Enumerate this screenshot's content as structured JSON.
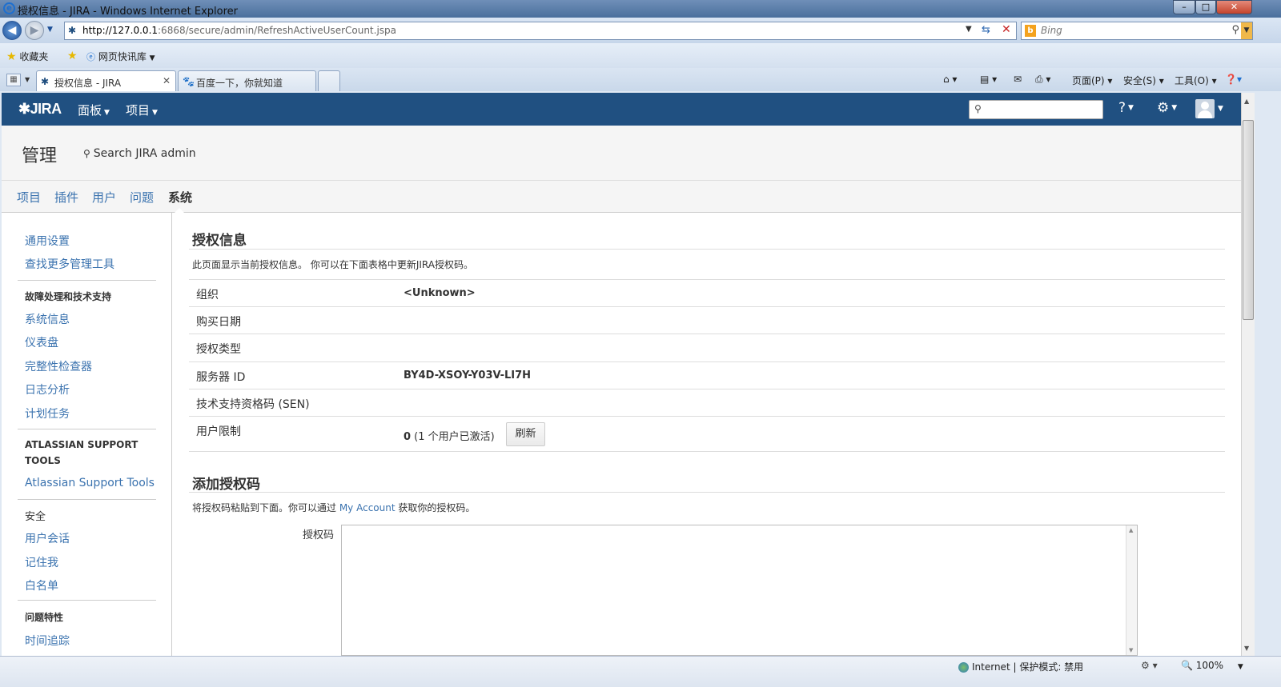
{
  "window": {
    "title": "授权信息 - JIRA - Windows Internet Explorer",
    "url_host": "http://127.0.0.1",
    "url_rest": ":6868/secure/admin/RefreshActiveUserCount.jspa",
    "search_placeholder": "Bing"
  },
  "favorites": {
    "favorites_label": "收藏夹",
    "webslice_label": "网页快讯库"
  },
  "tabs": [
    {
      "label": "授权信息 - JIRA"
    },
    {
      "label": "百度一下，你就知道"
    }
  ],
  "commandbar": {
    "page": "页面(P)",
    "safety": "安全(S)",
    "tools": "工具(O)"
  },
  "jira": {
    "logo": "JIRA",
    "nav": {
      "dashboards": "面板",
      "projects": "项目"
    }
  },
  "admin": {
    "title": "管理",
    "search_label": "Search JIRA admin",
    "tabs": [
      "项目",
      "插件",
      "用户",
      "问题",
      "系统"
    ],
    "active_tab": "系统"
  },
  "sidebar": {
    "link_general": "通用设置",
    "link_find_more": "查找更多管理工具",
    "head_troubleshooting": "故障处理和技术支持",
    "link_sysinfo": "系统信息",
    "link_instrumentation": "仪表盘",
    "link_integrity": "完整性检查器",
    "link_logging": "日志分析",
    "link_scheduler": "计划任务",
    "head_atlassian_1": "ATLASSIAN SUPPORT",
    "head_atlassian_2": "TOOLS",
    "link_support_tools": "Atlassian Support Tools",
    "head_security": "安全",
    "link_sessions": "用户会话",
    "link_rememberme": "记住我",
    "link_whitelist": "白名单",
    "head_issue_features": "问题特性",
    "link_time_tracking": "时间追踪"
  },
  "license": {
    "heading": "授权信息",
    "description": "此页面显示当前授权信息。 你可以在下面表格中更新JIRA授权码。",
    "rows": [
      {
        "label": "组织",
        "value": "<Unknown>"
      },
      {
        "label": "购买日期",
        "value": ""
      },
      {
        "label": "授权类型",
        "value": ""
      },
      {
        "label": "服务器 ID",
        "value": "BY4D-XSOY-Y03V-LI7H"
      },
      {
        "label": "技术支持资格码 (SEN)",
        "value": ""
      },
      {
        "label": "用户限制",
        "value": "0"
      }
    ],
    "user_limit_note": " (1 个用户已激活)",
    "refresh_button": "刷新"
  },
  "add_license": {
    "heading": "添加授权码",
    "desc_before": "将授权码粘贴到下面。你可以通过 ",
    "desc_link": "My Account",
    "desc_after": " 获取你的授权码。",
    "field_label": "授权码"
  },
  "statusbar": {
    "zone": "Internet | 保护模式: 禁用",
    "zoom": "100%"
  }
}
